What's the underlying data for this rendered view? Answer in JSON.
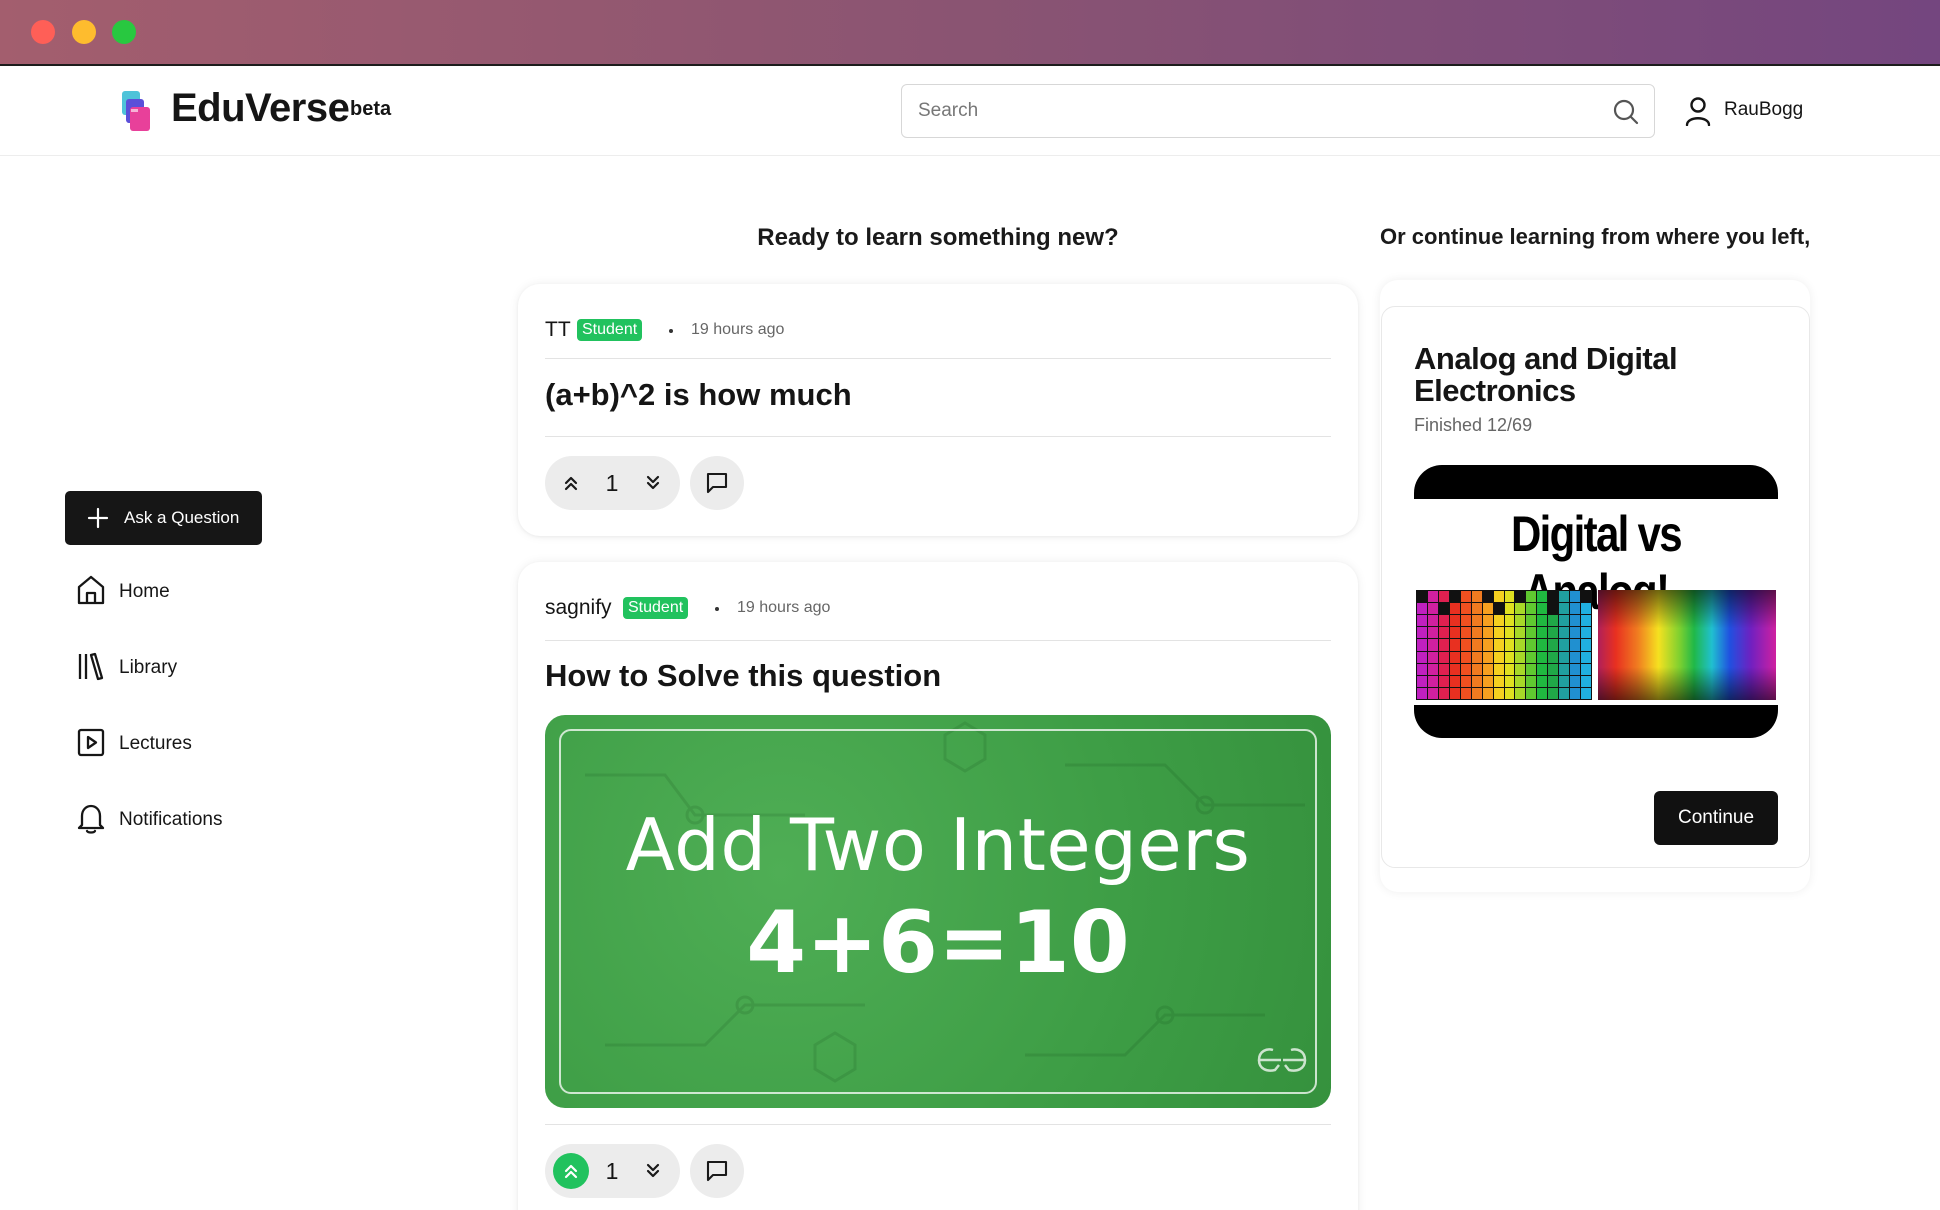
{
  "app": {
    "name": "EduVerse",
    "badge": "beta"
  },
  "search": {
    "placeholder": "Search",
    "value": ""
  },
  "user": {
    "name": "RauBogg"
  },
  "sidebar": {
    "ask_button": "Ask a Question",
    "items": [
      {
        "label": "Home",
        "icon": "home-icon"
      },
      {
        "label": "Library",
        "icon": "library-icon"
      },
      {
        "label": "Lectures",
        "icon": "lectures-icon"
      },
      {
        "label": "Notifications",
        "icon": "bell-icon"
      }
    ]
  },
  "feed": {
    "heading": "Ready to learn something new?",
    "posts": [
      {
        "author": "TT",
        "role": "Student",
        "time": "19 hours ago",
        "title": "(a+b)^2 is how much",
        "votes": "1",
        "upvoted": false
      },
      {
        "author": "sagnify",
        "role": "Student",
        "time": "19 hours ago",
        "title": "How to Solve this question",
        "image_text_1": "Add Two Integers",
        "image_text_2": "4+6=10",
        "votes": "1",
        "upvoted": true
      }
    ]
  },
  "continue_panel": {
    "heading": "Or continue learning from where you left,",
    "course": {
      "title": "Analog and Digital Electronics",
      "progress": "Finished 12/69",
      "thumbnail_text": "Digital vs Analog!",
      "button": "Continue"
    }
  },
  "colors": {
    "accent_green": "#21c25e",
    "dark": "#161616",
    "image_green": "#3d9d45"
  }
}
